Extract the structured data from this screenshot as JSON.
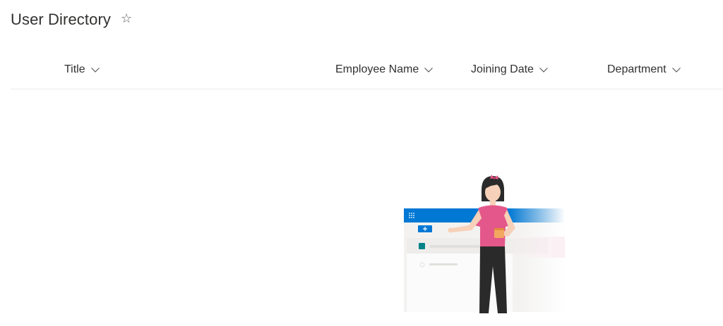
{
  "page": {
    "title": "User Directory",
    "favorite_icon": "star-outline-icon"
  },
  "list": {
    "columns": [
      {
        "label": "Title",
        "icon": "chevron-down-icon"
      },
      {
        "label": "Employee Name",
        "icon": "chevron-down-icon"
      },
      {
        "label": "Joining Date",
        "icon": "chevron-down-icon"
      },
      {
        "label": "Department",
        "icon": "chevron-down-icon"
      }
    ],
    "rows": []
  },
  "empty_state": {
    "illustration": "person-with-coffee-illustration"
  },
  "colors": {
    "text": "#323130",
    "accent": "#0078d4",
    "divider": "#edebe9",
    "shirt": "#e4578a",
    "teal": "#038387"
  }
}
